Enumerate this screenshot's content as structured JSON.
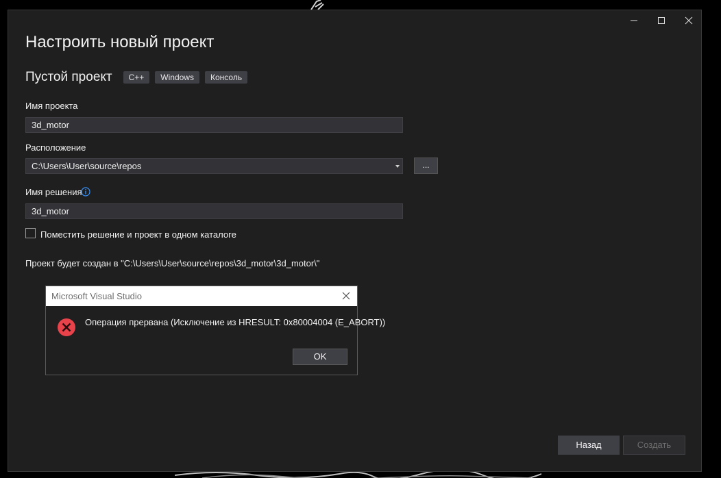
{
  "window": {
    "controls": {
      "minimize_icon": "minimize-icon",
      "maximize_icon": "maximize-icon",
      "close_icon": "close-icon"
    },
    "heading": "Настроить новый проект",
    "template": {
      "name": "Пустой проект",
      "tags": [
        "C++",
        "Windows",
        "Консоль"
      ]
    },
    "project_name": {
      "label": "Имя проекта",
      "value": "3d_motor"
    },
    "location": {
      "label": "Расположение",
      "value": "C:\\Users\\User\\source\\repos",
      "browse_label": "..."
    },
    "solution_name": {
      "label": "Имя решения",
      "value": "3d_motor",
      "info_icon": "info-icon"
    },
    "same_dir_checkbox": {
      "label": "Поместить решение и проект в одном каталоге",
      "checked": false
    },
    "path_text": "Проект будет создан в \"C:\\Users\\User\\source\\repos\\3d_motor\\3d_motor\\\"",
    "buttons": {
      "back": "Назад",
      "create": "Создать"
    }
  },
  "dialog": {
    "title": "Microsoft Visual Studio",
    "icon": "error-icon",
    "message": "Операция прервана (Исключение из HRESULT: 0x80004004 (E_ABORT))",
    "ok_label": "OK"
  },
  "colors": {
    "window_bg": "#1f1f1f",
    "field_bg": "#333337",
    "error_red": "#e8434b",
    "info_blue": "#3794ff"
  }
}
